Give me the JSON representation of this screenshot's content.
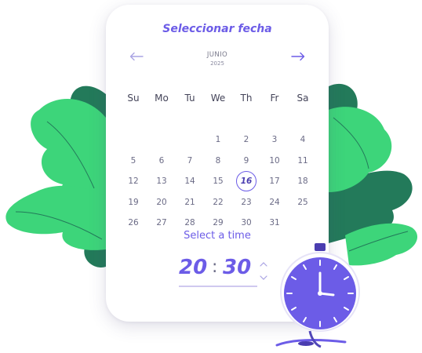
{
  "picker": {
    "title": "Seleccionar fecha",
    "month": "JUNIO",
    "year": "2025",
    "prev_icon": "arrow-left-icon",
    "next_icon": "arrow-right-icon",
    "weekdays": [
      "Su",
      "Mo",
      "Tu",
      "We",
      "Th",
      "Fr",
      "Sa"
    ],
    "weeks": [
      [
        "",
        "",
        "",
        "",
        "",
        "",
        ""
      ],
      [
        "",
        "",
        "",
        "1",
        "2",
        "3",
        "4"
      ],
      [
        "5",
        "6",
        "7",
        "8",
        "9",
        "10",
        "11"
      ],
      [
        "12",
        "13",
        "14",
        "15",
        "16",
        "17",
        "18"
      ],
      [
        "19",
        "20",
        "21",
        "22",
        "23",
        "24",
        "25"
      ],
      [
        "26",
        "27",
        "28",
        "29",
        "30",
        "31",
        ""
      ]
    ],
    "selected_day": "16"
  },
  "time": {
    "label": "Select a time",
    "hours": "20",
    "separator": ":",
    "minutes": "30",
    "up_icon": "chevron-up-icon",
    "down_icon": "chevron-down-icon"
  },
  "colors": {
    "accent": "#6c5ce7",
    "leaf_light": "#3dd57a",
    "leaf_dark": "#237a5a",
    "clock_face": "#6c5ce7"
  }
}
